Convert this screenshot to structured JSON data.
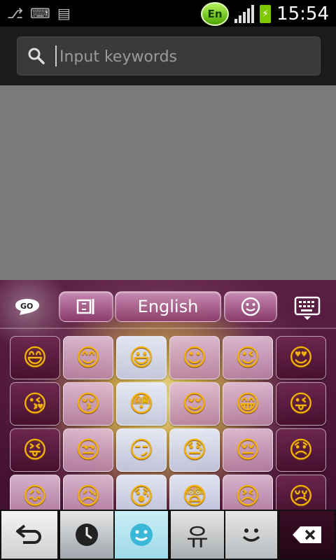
{
  "status_bar": {
    "left_icons": [
      "usb-icon",
      "keyboard-icon",
      "sim-icon"
    ],
    "language_badge": "En",
    "time": "15:54"
  },
  "search": {
    "placeholder": "Input keywords"
  },
  "keyboard": {
    "language_label": "English",
    "go_logo_text": "GO",
    "emoji_rows": [
      [
        "😄",
        "😊",
        "😃",
        "☺",
        "😉",
        "😍"
      ],
      [
        "😘",
        "😚",
        "😳",
        "😌",
        "😁",
        "😜"
      ],
      [
        "😝",
        "😒",
        "😏",
        "😓",
        "😔",
        "😞"
      ],
      [
        "😖",
        "😥",
        "😰",
        "😨",
        "😣",
        "😢"
      ]
    ],
    "bottom_tabs": [
      {
        "name": "back",
        "glyph": "↩"
      },
      {
        "name": "recent",
        "glyph": "🕓"
      },
      {
        "name": "emoji",
        "glyph": "☺"
      },
      {
        "name": "korean-emoticon",
        "glyph": "유"
      },
      {
        "name": "smiley",
        "glyph": "◡"
      },
      {
        "name": "delete",
        "glyph": "⌫"
      }
    ]
  },
  "colors": {
    "keyboard_bg": "#4a1536",
    "key_light": "#d9b6cc",
    "accent_battery": "#7ec800"
  }
}
